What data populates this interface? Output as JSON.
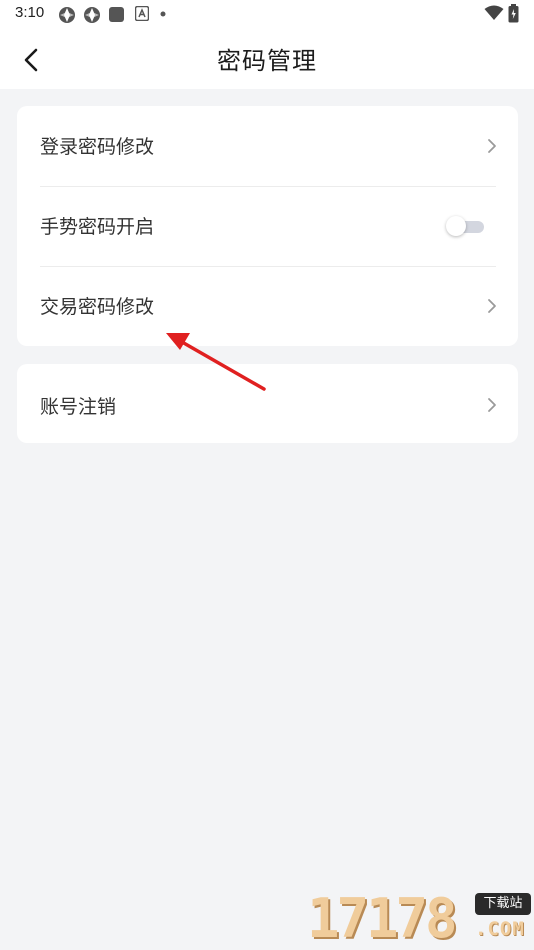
{
  "status_bar": {
    "time": "3:10",
    "left_icons": [
      "pinwheel-icon",
      "pinwheel-icon",
      "square-app-icon",
      "a-box-icon",
      "dot-icon"
    ],
    "right_icons": [
      "wifi-icon",
      "battery-icon"
    ]
  },
  "header": {
    "title": "密码管理",
    "back_icon": "chevron-left-icon"
  },
  "settings": {
    "group1": [
      {
        "label": "登录密码修改",
        "control": "chevron"
      },
      {
        "label": "手势密码开启",
        "control": "toggle",
        "enabled": false
      },
      {
        "label": "交易密码修改",
        "control": "chevron"
      }
    ],
    "group2": [
      {
        "label": "账号注销",
        "control": "chevron"
      }
    ]
  },
  "annotation": {
    "type": "red-arrow",
    "color": "#e02020"
  },
  "watermark": {
    "number": "17178",
    "badge": "下载站",
    "suffix": ".COM"
  }
}
